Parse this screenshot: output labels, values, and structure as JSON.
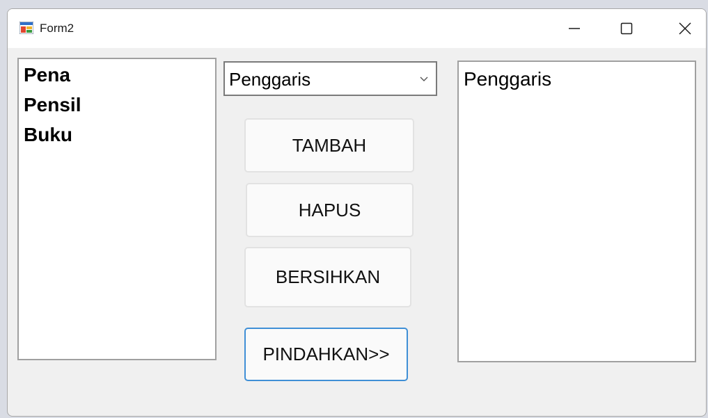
{
  "window": {
    "title": "Form2",
    "icon": "winforms-form-icon"
  },
  "title_buttons": {
    "minimize": "minimize-icon",
    "maximize": "maximize-icon",
    "close": "close-icon"
  },
  "left_list": {
    "items": [
      "Pena",
      "Pensil",
      "Buku"
    ]
  },
  "combo": {
    "value": "Penggaris"
  },
  "buttons": {
    "tambah": "TAMBAH",
    "hapus": "HAPUS",
    "bersihkan": "BERSIHKAN",
    "pindahkan": "PINDAHKAN>>"
  },
  "right_list": {
    "items": [
      "Penggaris"
    ]
  },
  "colors": {
    "accent_border": "#3f8fd6",
    "form_background": "#f0f0f0"
  }
}
